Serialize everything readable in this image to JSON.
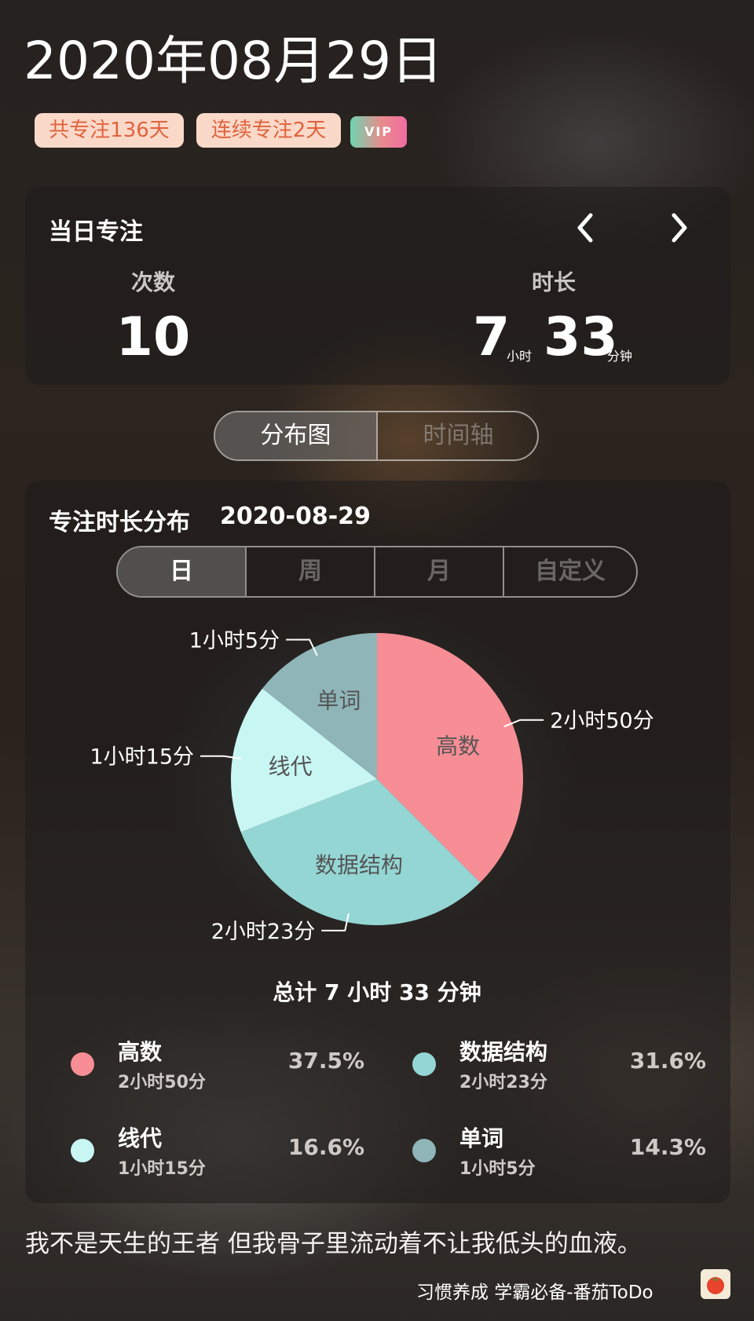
{
  "header": {
    "date": "2020年08月29日",
    "badges": {
      "total": "共专注136天",
      "streak": "连续专注2天",
      "vip": "VIP"
    }
  },
  "day_focus": {
    "title": "当日专注",
    "prev_icon": "chevron-left-icon",
    "next_icon": "chevron-right-icon",
    "count_label": "次数",
    "count_value": "10",
    "duration_label": "时长",
    "hours_value": "7",
    "hours_unit": "小时",
    "minutes_value": "33",
    "minutes_unit": "分钟"
  },
  "view_tabs": {
    "distribution": "分布图",
    "timeline": "时间轴",
    "selected": "分布图"
  },
  "distribution": {
    "title": "专注时长分布",
    "date": "2020-08-29",
    "range_tabs": [
      "日",
      "周",
      "月",
      "自定义"
    ],
    "selected_range": "日",
    "total": "总计 7 小时 33 分钟"
  },
  "chart_data": {
    "type": "pie",
    "unit": "minutes",
    "slices": [
      {
        "name": "高数",
        "value": 170,
        "label": "2小时50分",
        "percent": "37.5%",
        "color": "#f78e95"
      },
      {
        "name": "数据结构",
        "value": 143,
        "label": "2小时23分",
        "percent": "31.6%",
        "color": "#94d6d4"
      },
      {
        "name": "线代",
        "value": 75,
        "label": "1小时15分",
        "percent": "16.6%",
        "color": "#c8f6f3"
      },
      {
        "name": "单词",
        "value": 65,
        "label": "1小时5分",
        "percent": "14.3%",
        "color": "#8fb5b8"
      }
    ]
  },
  "quote": "我不是天生的王者 但我骨子里流动着不让我低头的血液。",
  "footer": {
    "text": "习惯养成 学霸必备-番茄ToDo",
    "icon": "tomato-icon"
  }
}
